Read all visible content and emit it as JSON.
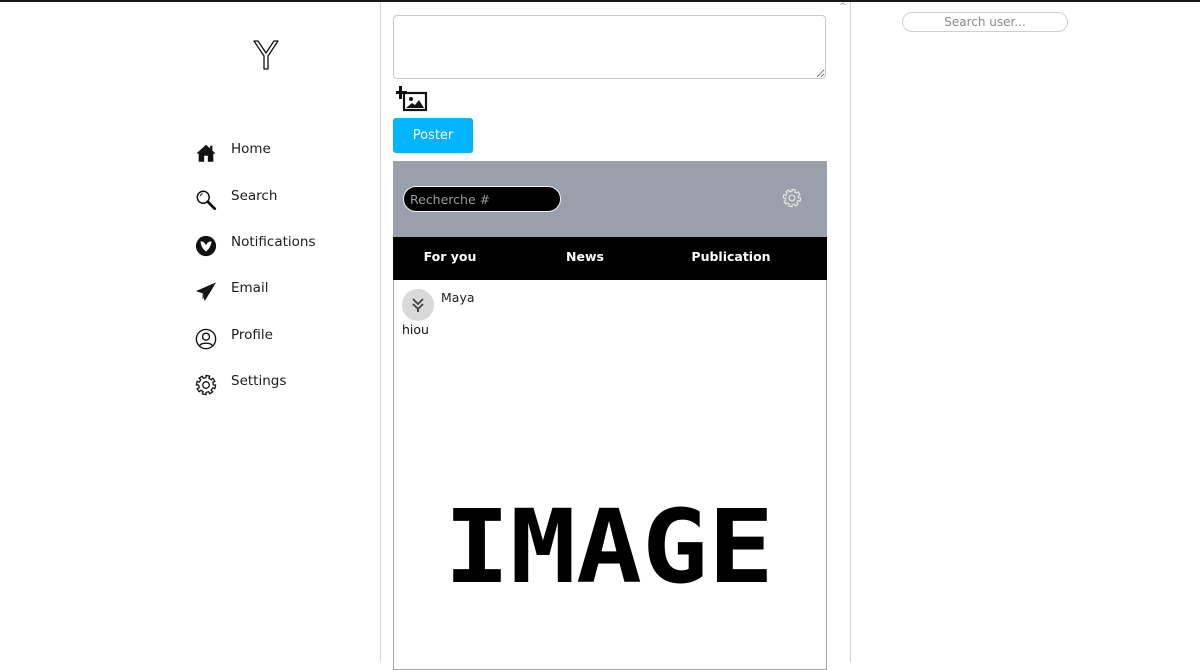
{
  "nav": {
    "logo_icon": "y-logo-icon",
    "items": [
      {
        "label": "Home",
        "icon": "home-icon"
      },
      {
        "label": "Search",
        "icon": "search-icon"
      },
      {
        "label": "Notifications",
        "icon": "notifications-icon"
      },
      {
        "label": "Email",
        "icon": "paper-plane-icon"
      },
      {
        "label": "Profile",
        "icon": "user-circle-icon"
      },
      {
        "label": "Settings",
        "icon": "gear-icon"
      }
    ]
  },
  "compose": {
    "value": "",
    "add_image_icon": "add-image-icon",
    "post_label": "Poster"
  },
  "feed": {
    "hashtag_placeholder": "Recherche #",
    "settings_icon": "gear-icon",
    "tabs": [
      {
        "label": "For you"
      },
      {
        "label": "News"
      },
      {
        "label": "Publication"
      }
    ],
    "post": {
      "author": "Maya",
      "text": "hiou",
      "image_text": "IMAGE"
    }
  },
  "right": {
    "search_placeholder": "Search user..."
  },
  "colors": {
    "accent": "#00b4ff",
    "header_bg": "#9aa0a9",
    "tabs_bg": "#000000"
  }
}
